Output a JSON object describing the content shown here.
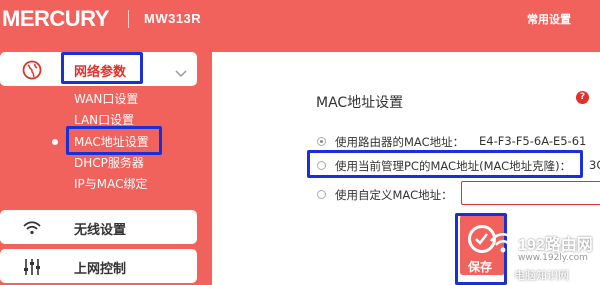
{
  "header": {
    "brand": "MERCURY",
    "model": "MW313R",
    "common_settings": "常用设置"
  },
  "sidebar": {
    "groups": [
      {
        "label": "网络参数",
        "icon": "globe-icon",
        "expanded": true
      },
      {
        "label": "无线设置",
        "icon": "wifi-icon"
      },
      {
        "label": "上网控制",
        "icon": "sliders-icon"
      }
    ],
    "sub_items": [
      {
        "label": "WAN口设置"
      },
      {
        "label": "LAN口设置"
      },
      {
        "label": "MAC地址设置",
        "active": true
      },
      {
        "label": "DHCP服务器"
      },
      {
        "label": "IP与MAC绑定"
      }
    ]
  },
  "main": {
    "title": "MAC地址设置",
    "help": "?",
    "options": [
      {
        "label": "使用路由器的MAC地址：",
        "value": "E4-F3-F5-6A-E5-61",
        "selected": true
      },
      {
        "label": "使用当前管理PC的MAC地址(MAC地址克隆)：",
        "value": "3C"
      },
      {
        "label": "使用自定义MAC地址："
      }
    ],
    "custom_mac_value": "",
    "save_label": "保存"
  },
  "watermark": {
    "brand": "192路由网",
    "url": "www.192ly.com",
    "sub": "电脑知识网"
  },
  "colors": {
    "accent": "#f2625d",
    "highlight_box": "#1a2fd6",
    "active_text": "#e0322a"
  }
}
